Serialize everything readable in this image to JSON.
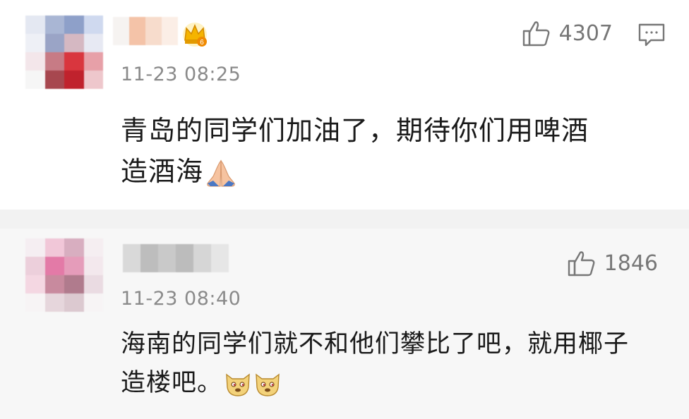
{
  "comments": [
    {
      "time": "11-23 08:25",
      "likes": "4307",
      "text_line1": "青岛的同学们加油了，期待你们用啤酒",
      "text_line2": "造酒海",
      "emoji": "🙏",
      "has_crown_badge": true,
      "badge_level": "6"
    },
    {
      "time": "11-23 08:40",
      "likes": "1846",
      "text_line1": "海南的同学们就不和他们攀比了吧，就用椰子",
      "text_line2": "造楼吧。",
      "emoji": "doge"
    }
  ],
  "icons": {
    "like": "thumbs-up-icon",
    "reply": "comment-bubble-icon",
    "crown": "crown-badge-icon"
  },
  "colors": {
    "text": "#1a1a1a",
    "meta": "#8a8a8a",
    "icon": "#777777",
    "crown": "#f5b400",
    "separator": "#f2f2f2"
  }
}
